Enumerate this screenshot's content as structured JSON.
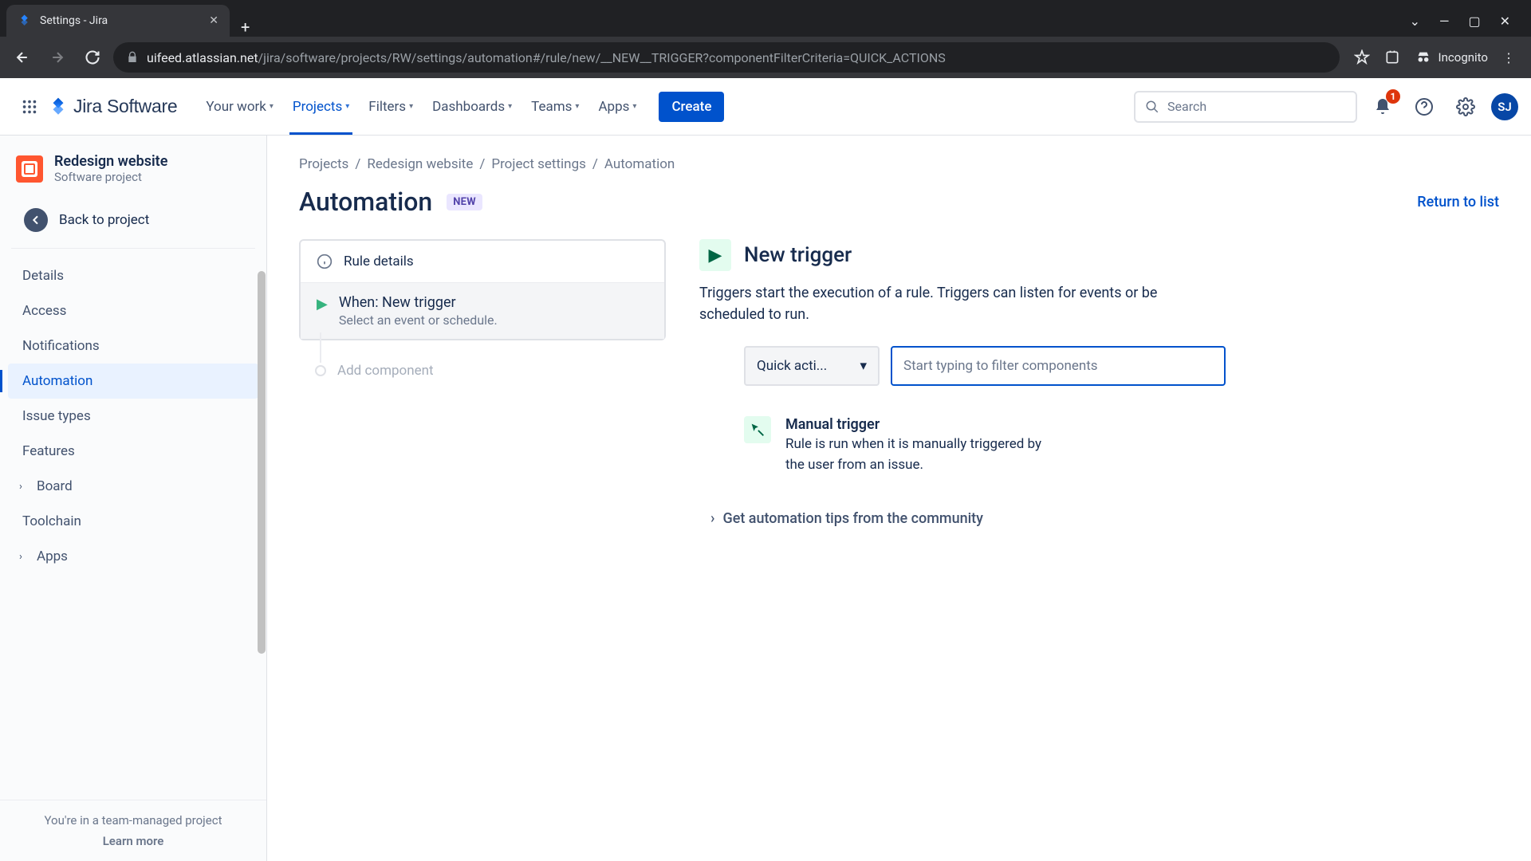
{
  "browser": {
    "tab_title": "Settings - Jira",
    "url_host": "uifeed.atlassian.net",
    "url_path": "/jira/software/projects/RW/settings/automation#/rule/new/__NEW__TRIGGER?componentFilterCriteria=QUICK_ACTIONS",
    "incognito_label": "Incognito"
  },
  "nav": {
    "product": "Jira Software",
    "items": [
      "Your work",
      "Projects",
      "Filters",
      "Dashboards",
      "Teams",
      "Apps"
    ],
    "active_index": 1,
    "create": "Create",
    "search_placeholder": "Search",
    "notif_count": "1",
    "avatar_initials": "SJ"
  },
  "sidebar": {
    "project_name": "Redesign website",
    "project_type": "Software project",
    "back_label": "Back to project",
    "items": [
      {
        "label": "Details"
      },
      {
        "label": "Access"
      },
      {
        "label": "Notifications"
      },
      {
        "label": "Automation",
        "active": true
      },
      {
        "label": "Issue types"
      },
      {
        "label": "Features"
      },
      {
        "label": "Board",
        "expandable": true
      },
      {
        "label": "Toolchain"
      },
      {
        "label": "Apps",
        "expandable": true
      }
    ],
    "footer_text": "You're in a team-managed project",
    "footer_link": "Learn more"
  },
  "breadcrumbs": [
    "Projects",
    "Redesign website",
    "Project settings",
    "Automation"
  ],
  "page": {
    "title": "Automation",
    "badge": "NEW",
    "return_link": "Return to list"
  },
  "rule": {
    "details_label": "Rule details",
    "trigger_title": "When: New trigger",
    "trigger_sub": "Select an event or schedule.",
    "add_label": "Add component"
  },
  "detail": {
    "title": "New trigger",
    "description": "Triggers start the execution of a rule. Triggers can listen for events or be scheduled to run.",
    "dropdown_label": "Quick acti...",
    "filter_placeholder": "Start typing to filter components",
    "option_title": "Manual trigger",
    "option_desc": "Rule is run when it is manually triggered by the user from an issue.",
    "tips_link": "Get automation tips from the community"
  }
}
